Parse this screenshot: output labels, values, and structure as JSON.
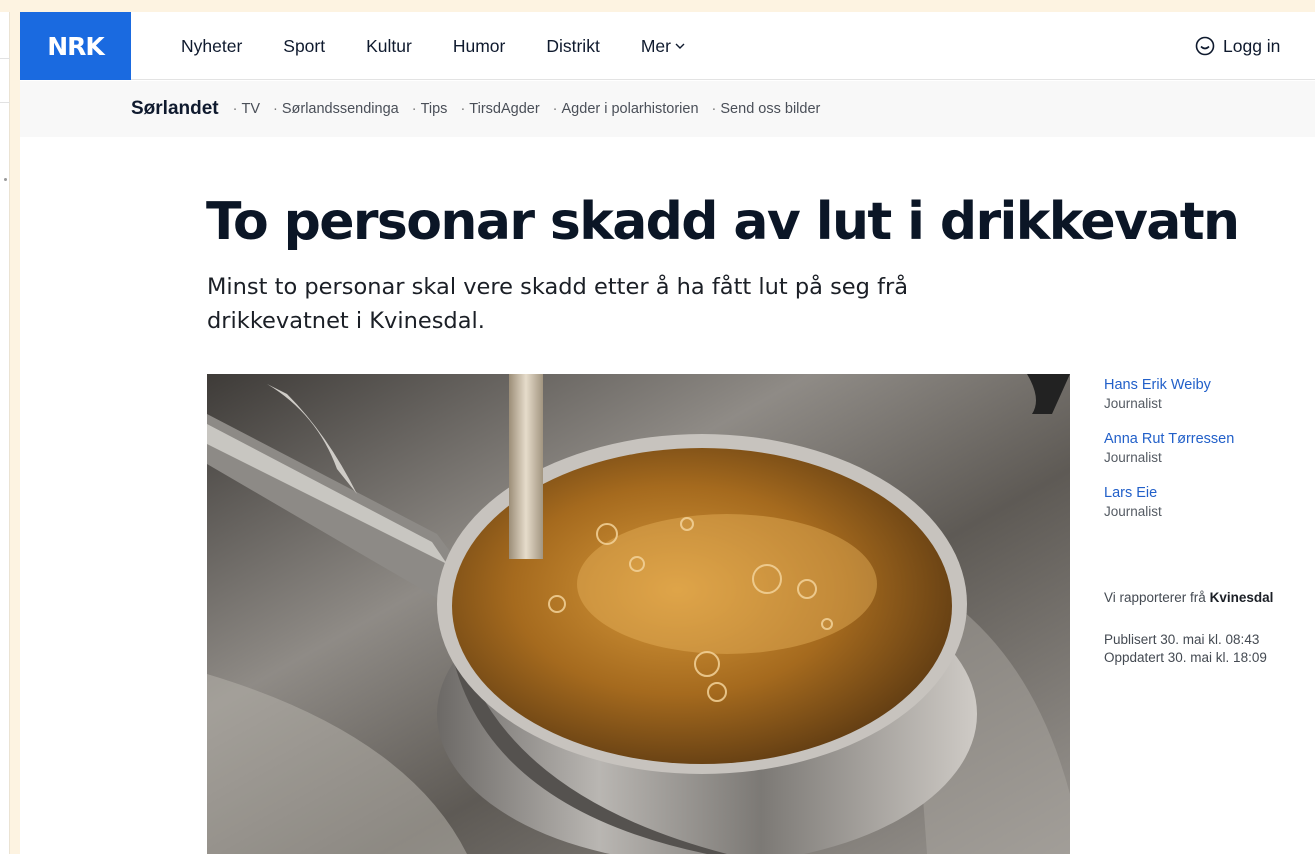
{
  "brand": {
    "logo_text": "NRK",
    "logo_color": "#1a6ae0"
  },
  "topnav": {
    "items": [
      {
        "label": "Nyheter"
      },
      {
        "label": "Sport"
      },
      {
        "label": "Kultur"
      },
      {
        "label": "Humor"
      },
      {
        "label": "Distrikt"
      }
    ],
    "more_label": "Mer",
    "more_icon": "chevron-down-icon",
    "login_label": "Logg in",
    "login_icon": "user-circle-icon"
  },
  "subnav": {
    "region": "Sørlandet",
    "links": [
      {
        "label": "TV"
      },
      {
        "label": "Sørlandssendinga"
      },
      {
        "label": "Tips"
      },
      {
        "label": "TirsdAgder"
      },
      {
        "label": "Agder i polarhistorien"
      },
      {
        "label": "Send oss bilder"
      }
    ]
  },
  "article": {
    "headline": "To personar skadd av lut i drikkevatn",
    "lead": "Minst to personar skal vere skadd etter å ha fått lut på seg frå drikkevatnet i Kvinesdal.",
    "image_description_icon": "water-pot-photo",
    "authors": [
      {
        "name": "Hans Erik Weiby",
        "role": "Journalist"
      },
      {
        "name": "Anna Rut Tørressen",
        "role": "Journalist"
      },
      {
        "name": "Lars Eie",
        "role": "Journalist"
      }
    ],
    "reporting_prefix": "Vi rapporterer frå",
    "reporting_place": "Kvinesdal",
    "published": "Publisert 30. mai kl. 08:43",
    "updated": "Oppdatert 30. mai kl. 18:09"
  },
  "colors": {
    "link": "#2260c9",
    "text": "#0b1626",
    "subnav_bg": "#f8f8f8",
    "backdrop": "#fdf3e1"
  }
}
